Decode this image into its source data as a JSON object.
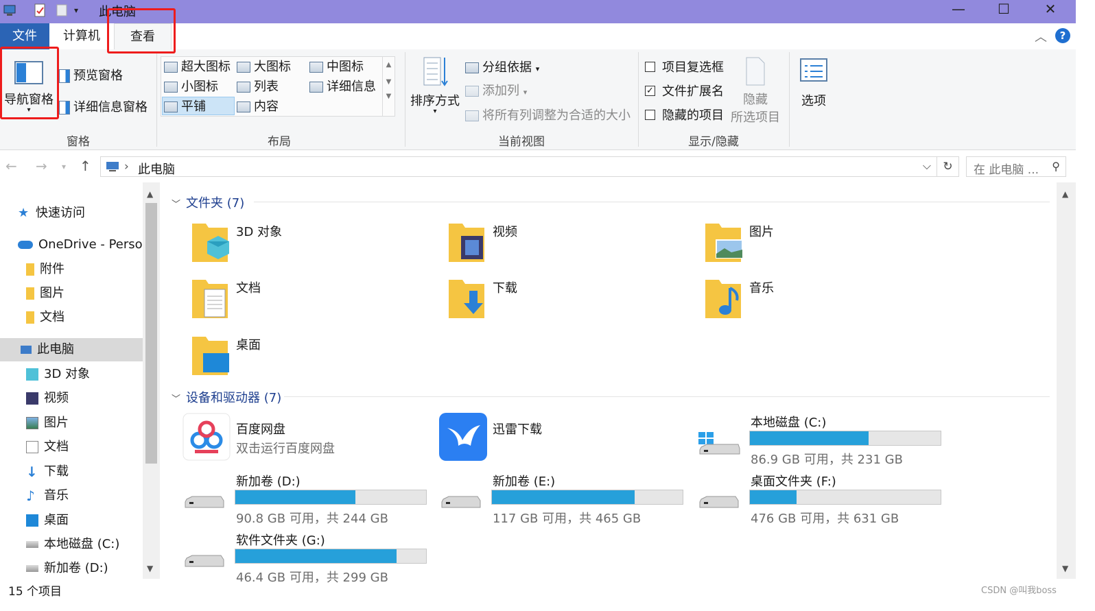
{
  "window": {
    "title": "此电脑",
    "minimize": "—",
    "maximize": "☐",
    "close": "✕"
  },
  "tabs": [
    {
      "label": "文件"
    },
    {
      "label": "计算机"
    },
    {
      "label": "查看"
    }
  ],
  "ribbon": {
    "panes": {
      "nav_pane": "导航窗格",
      "preview_pane": "预览窗格",
      "details_pane": "详细信息窗格",
      "group": "窗格"
    },
    "layout": {
      "extra_large": "超大图标",
      "large": "大图标",
      "medium": "中图标",
      "small": "小图标",
      "list": "列表",
      "details": "详细信息",
      "tiles": "平铺",
      "content": "内容",
      "group": "布局"
    },
    "current_view": {
      "sort": "排序方式",
      "group_by": "分组依据",
      "add_column": "添加列",
      "fit_columns": "将所有列调整为合适的大小",
      "group": "当前视图"
    },
    "show_hide": {
      "item_checkboxes": "项目复选框",
      "file_extensions": "文件扩展名",
      "hidden_items": "隐藏的项目",
      "hide_selected_1": "隐藏",
      "hide_selected_2": "所选项目",
      "group": "显示/隐藏"
    },
    "options": "选项"
  },
  "address": {
    "path": "此电脑",
    "search_placeholder": "在 此电脑 ..."
  },
  "sidebar": {
    "items": [
      {
        "label": "快速访问"
      },
      {
        "label": "OneDrive - Person"
      },
      {
        "label": "附件"
      },
      {
        "label": "图片"
      },
      {
        "label": "文档"
      },
      {
        "label": "此电脑"
      },
      {
        "label": "3D 对象"
      },
      {
        "label": "视频"
      },
      {
        "label": "图片"
      },
      {
        "label": "文档"
      },
      {
        "label": "下载"
      },
      {
        "label": "音乐"
      },
      {
        "label": "桌面"
      },
      {
        "label": "本地磁盘 (C:)"
      },
      {
        "label": "新加卷 (D:)"
      }
    ]
  },
  "folders_section": {
    "header": "文件夹 (7)",
    "items": [
      {
        "name": "3D 对象"
      },
      {
        "name": "视频"
      },
      {
        "name": "图片"
      },
      {
        "name": "文档"
      },
      {
        "name": "下载"
      },
      {
        "name": "音乐"
      },
      {
        "name": "桌面"
      }
    ]
  },
  "devices_section": {
    "header": "设备和驱动器 (7)",
    "apps": [
      {
        "name": "百度网盘",
        "sub": "双击运行百度网盘"
      },
      {
        "name": "迅雷下载"
      }
    ],
    "drives": [
      {
        "name": "本地磁盘 (C:)",
        "info": "86.9 GB 可用，共 231 GB",
        "used_fraction": 0.624
      },
      {
        "name": "新加卷 (D:)",
        "info": "90.8 GB 可用，共 244 GB",
        "used_fraction": 0.628
      },
      {
        "name": "新加卷 (E:)",
        "info": "117 GB 可用，共 465 GB",
        "used_fraction": 0.748
      },
      {
        "name": "桌面文件夹 (F:)",
        "info": "476 GB 可用，共 631 GB",
        "used_fraction": 0.246
      },
      {
        "name": "软件文件夹 (G:)",
        "info": "46.4 GB 可用，共 299 GB",
        "used_fraction": 0.845
      }
    ]
  },
  "status": {
    "count": "15 个项目"
  },
  "watermark": "CSDN @叫我boss",
  "colors": {
    "titlebar": "#9189dd",
    "file_tab": "#2b64b5",
    "accent_blue": "#26a0da",
    "highlight_red": "#ee1c1c"
  }
}
